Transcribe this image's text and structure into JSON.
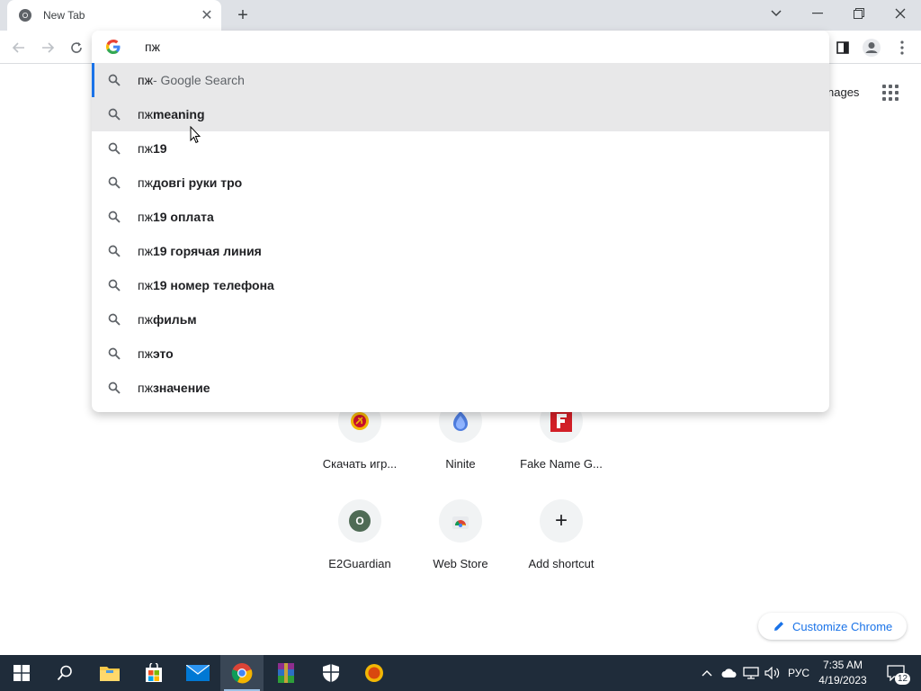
{
  "tab": {
    "title": "New Tab",
    "close_glyph": "✕",
    "new_tab_glyph": "+"
  },
  "omnibox": {
    "query": "пж",
    "suggestions": [
      {
        "prefix": "пж",
        "bold": "",
        "suffix": " - Google Search",
        "state": "selected"
      },
      {
        "prefix": "пж ",
        "bold": "meaning",
        "suffix": "",
        "state": "hover"
      },
      {
        "prefix": "пж ",
        "bold": "19",
        "suffix": "",
        "state": ""
      },
      {
        "prefix": "пж ",
        "bold": "довгі руки тро",
        "suffix": "",
        "state": ""
      },
      {
        "prefix": "пж",
        "bold": "19 оплата",
        "suffix": "",
        "state": ""
      },
      {
        "prefix": "пж ",
        "bold": "19 горячая линия",
        "suffix": "",
        "state": ""
      },
      {
        "prefix": "пж ",
        "bold": "19 номер телефона",
        "suffix": "",
        "state": ""
      },
      {
        "prefix": "пж ",
        "bold": "фильм",
        "suffix": "",
        "state": ""
      },
      {
        "prefix": "пж ",
        "bold": "это",
        "suffix": "",
        "state": ""
      },
      {
        "prefix": "пж ",
        "bold": "значение",
        "suffix": "",
        "state": ""
      }
    ]
  },
  "ntp": {
    "images_link": "nages",
    "shortcuts": [
      {
        "label": "Скачать игр...",
        "icon": "soviet-emblem-icon"
      },
      {
        "label": "Ninite",
        "icon": "ninite-icon"
      },
      {
        "label": "Fake Name G...",
        "icon": "fake-name-icon"
      },
      {
        "label": "E2Guardian",
        "icon": "e2guardian-icon",
        "letter": "O"
      },
      {
        "label": "Web Store",
        "icon": "web-store-icon"
      },
      {
        "label": "Add shortcut",
        "icon": "plus-icon",
        "glyph": "+"
      }
    ],
    "customize_label": "Customize Chrome"
  },
  "taskbar": {
    "language": "РУС",
    "time": "7:35 AM",
    "date": "4/19/2023",
    "notification_count": "12"
  },
  "colors": {
    "accent": "#1a73e8",
    "taskbar": "#1f2c3a",
    "tabstrip": "#dee1e6"
  }
}
